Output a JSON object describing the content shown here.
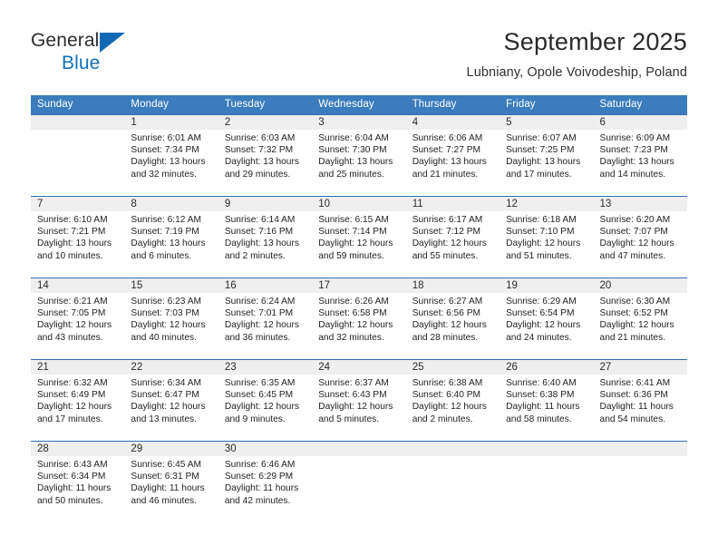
{
  "brand": {
    "line1": "General",
    "line2": "Blue",
    "accent_color": "#1268b3"
  },
  "header": {
    "month_title": "September 2025",
    "location": "Lubniany, Opole Voivodeship, Poland"
  },
  "theme": {
    "header_bar_color": "#3a7cbd",
    "row_divider_color": "#2f6fb0",
    "daynum_band_color": "#efefef"
  },
  "weekdays": [
    "Sunday",
    "Monday",
    "Tuesday",
    "Wednesday",
    "Thursday",
    "Friday",
    "Saturday"
  ],
  "weeks": [
    [
      {
        "day": "",
        "info": ""
      },
      {
        "day": "1",
        "info": "Sunrise: 6:01 AM\nSunset: 7:34 PM\nDaylight: 13 hours\nand 32 minutes."
      },
      {
        "day": "2",
        "info": "Sunrise: 6:03 AM\nSunset: 7:32 PM\nDaylight: 13 hours\nand 29 minutes."
      },
      {
        "day": "3",
        "info": "Sunrise: 6:04 AM\nSunset: 7:30 PM\nDaylight: 13 hours\nand 25 minutes."
      },
      {
        "day": "4",
        "info": "Sunrise: 6:06 AM\nSunset: 7:27 PM\nDaylight: 13 hours\nand 21 minutes."
      },
      {
        "day": "5",
        "info": "Sunrise: 6:07 AM\nSunset: 7:25 PM\nDaylight: 13 hours\nand 17 minutes."
      },
      {
        "day": "6",
        "info": "Sunrise: 6:09 AM\nSunset: 7:23 PM\nDaylight: 13 hours\nand 14 minutes."
      }
    ],
    [
      {
        "day": "7",
        "info": "Sunrise: 6:10 AM\nSunset: 7:21 PM\nDaylight: 13 hours\nand 10 minutes."
      },
      {
        "day": "8",
        "info": "Sunrise: 6:12 AM\nSunset: 7:19 PM\nDaylight: 13 hours\nand 6 minutes."
      },
      {
        "day": "9",
        "info": "Sunrise: 6:14 AM\nSunset: 7:16 PM\nDaylight: 13 hours\nand 2 minutes."
      },
      {
        "day": "10",
        "info": "Sunrise: 6:15 AM\nSunset: 7:14 PM\nDaylight: 12 hours\nand 59 minutes."
      },
      {
        "day": "11",
        "info": "Sunrise: 6:17 AM\nSunset: 7:12 PM\nDaylight: 12 hours\nand 55 minutes."
      },
      {
        "day": "12",
        "info": "Sunrise: 6:18 AM\nSunset: 7:10 PM\nDaylight: 12 hours\nand 51 minutes."
      },
      {
        "day": "13",
        "info": "Sunrise: 6:20 AM\nSunset: 7:07 PM\nDaylight: 12 hours\nand 47 minutes."
      }
    ],
    [
      {
        "day": "14",
        "info": "Sunrise: 6:21 AM\nSunset: 7:05 PM\nDaylight: 12 hours\nand 43 minutes."
      },
      {
        "day": "15",
        "info": "Sunrise: 6:23 AM\nSunset: 7:03 PM\nDaylight: 12 hours\nand 40 minutes."
      },
      {
        "day": "16",
        "info": "Sunrise: 6:24 AM\nSunset: 7:01 PM\nDaylight: 12 hours\nand 36 minutes."
      },
      {
        "day": "17",
        "info": "Sunrise: 6:26 AM\nSunset: 6:58 PM\nDaylight: 12 hours\nand 32 minutes."
      },
      {
        "day": "18",
        "info": "Sunrise: 6:27 AM\nSunset: 6:56 PM\nDaylight: 12 hours\nand 28 minutes."
      },
      {
        "day": "19",
        "info": "Sunrise: 6:29 AM\nSunset: 6:54 PM\nDaylight: 12 hours\nand 24 minutes."
      },
      {
        "day": "20",
        "info": "Sunrise: 6:30 AM\nSunset: 6:52 PM\nDaylight: 12 hours\nand 21 minutes."
      }
    ],
    [
      {
        "day": "21",
        "info": "Sunrise: 6:32 AM\nSunset: 6:49 PM\nDaylight: 12 hours\nand 17 minutes."
      },
      {
        "day": "22",
        "info": "Sunrise: 6:34 AM\nSunset: 6:47 PM\nDaylight: 12 hours\nand 13 minutes."
      },
      {
        "day": "23",
        "info": "Sunrise: 6:35 AM\nSunset: 6:45 PM\nDaylight: 12 hours\nand 9 minutes."
      },
      {
        "day": "24",
        "info": "Sunrise: 6:37 AM\nSunset: 6:43 PM\nDaylight: 12 hours\nand 5 minutes."
      },
      {
        "day": "25",
        "info": "Sunrise: 6:38 AM\nSunset: 6:40 PM\nDaylight: 12 hours\nand 2 minutes."
      },
      {
        "day": "26",
        "info": "Sunrise: 6:40 AM\nSunset: 6:38 PM\nDaylight: 11 hours\nand 58 minutes."
      },
      {
        "day": "27",
        "info": "Sunrise: 6:41 AM\nSunset: 6:36 PM\nDaylight: 11 hours\nand 54 minutes."
      }
    ],
    [
      {
        "day": "28",
        "info": "Sunrise: 6:43 AM\nSunset: 6:34 PM\nDaylight: 11 hours\nand 50 minutes."
      },
      {
        "day": "29",
        "info": "Sunrise: 6:45 AM\nSunset: 6:31 PM\nDaylight: 11 hours\nand 46 minutes."
      },
      {
        "day": "30",
        "info": "Sunrise: 6:46 AM\nSunset: 6:29 PM\nDaylight: 11 hours\nand 42 minutes."
      },
      {
        "day": "",
        "info": ""
      },
      {
        "day": "",
        "info": ""
      },
      {
        "day": "",
        "info": ""
      },
      {
        "day": "",
        "info": ""
      }
    ]
  ]
}
